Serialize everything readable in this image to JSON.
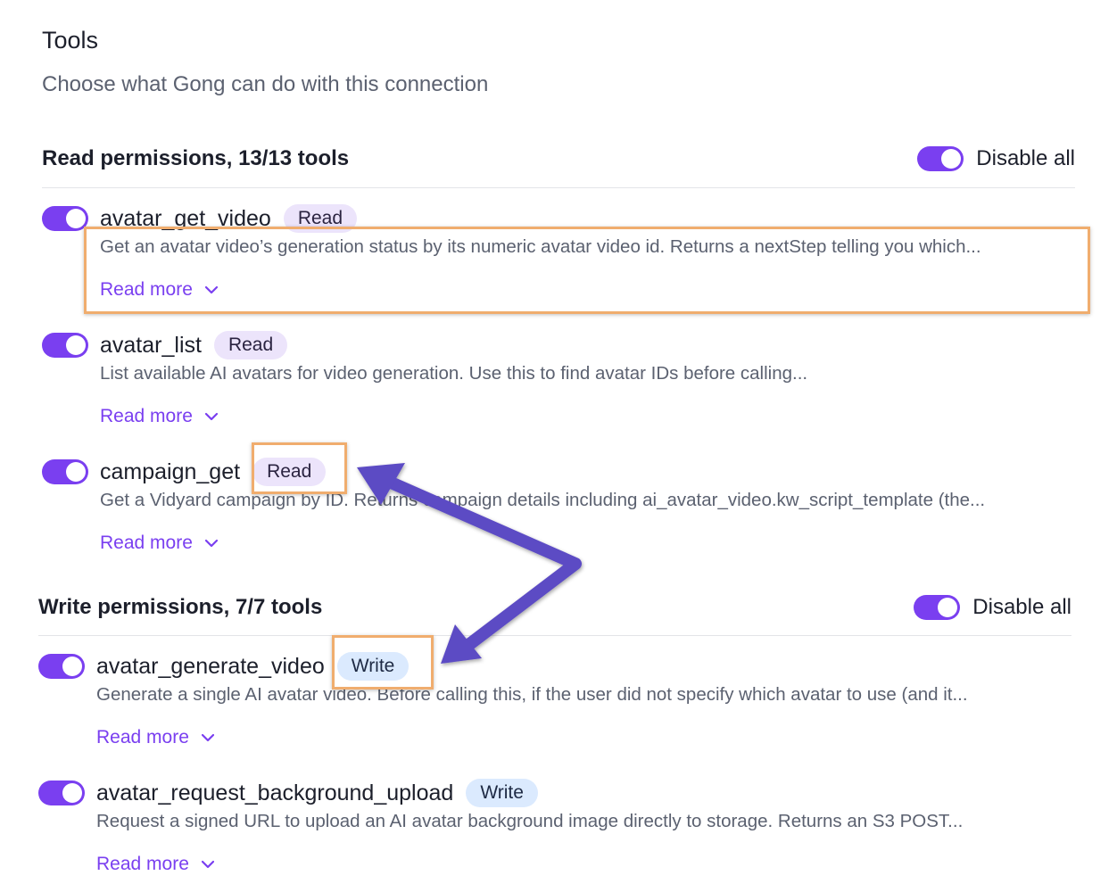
{
  "header": {
    "title": "Tools",
    "subtitle": "Choose what Gong can do with this connection"
  },
  "read_section": {
    "title": "Read permissions, 13/13 tools",
    "disable_all_label": "Disable all",
    "tools": [
      {
        "name": "avatar_get_video",
        "badge": "Read",
        "description": "Get an avatar video’s generation status by its numeric avatar video id. Returns a nextStep telling you which...",
        "read_more": "Read more",
        "enabled": true
      },
      {
        "name": "avatar_list",
        "badge": "Read",
        "description": "List available AI avatars for video generation. Use this to find avatar IDs before calling...",
        "read_more": "Read more",
        "enabled": true
      },
      {
        "name": "campaign_get",
        "badge": "Read",
        "description": "Get a Vidyard campaign by ID. Returns campaign details including ai_avatar_video.kw_script_template (the...",
        "read_more": "Read more",
        "enabled": true
      }
    ]
  },
  "write_section": {
    "title": "Write permissions, 7/7 tools",
    "disable_all_label": "Disable all",
    "tools": [
      {
        "name": "avatar_generate_video",
        "badge": "Write",
        "description": "Generate a single AI avatar video. Before calling this, if the user did not specify which avatar to use (and it...",
        "read_more": "Read more",
        "enabled": true
      },
      {
        "name": "avatar_request_background_upload",
        "badge": "Write",
        "description": "Request a signed URL to upload an AI avatar background image directly to storage. Returns an S3 POST...",
        "read_more": "Read more",
        "enabled": true
      }
    ]
  },
  "colors": {
    "accent": "#7a3ff0",
    "read_badge_bg": "#ece4fb",
    "write_badge_bg": "#dbeafe",
    "highlight": "#f0ad6e",
    "annotation_arrow": "#5b4bc4"
  },
  "icons": {
    "read_more_chevron": "chevron-down-icon"
  }
}
